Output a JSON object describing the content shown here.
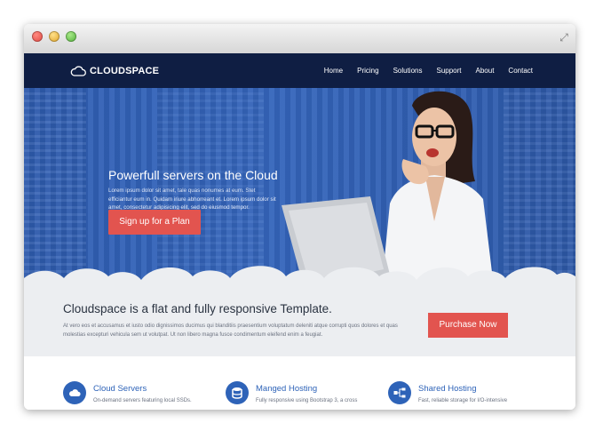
{
  "brand": {
    "name": "CLOUDSPACE"
  },
  "nav": {
    "items": [
      "Home",
      "Pricing",
      "Solutions",
      "Support",
      "About",
      "Contact"
    ]
  },
  "hero": {
    "title": "Powerfull servers on the Cloud",
    "text": "Lorem ipsum dolor sit amet, tale quas nonumes at eum. Stet efficiantur eum in. Quidam iriure abhorreant et. Lorem ipsum dolor sit amet, consectetur adipisicing elit, sed do eiusmod tempor.",
    "cta": "Sign up for a Plan"
  },
  "intro": {
    "title": "Cloudspace is a flat and fully responsive Template.",
    "text": "At vero eos et accusamus et iusto odio dignissimos ducimus qui blanditiis praesentium voluptatum deleniti atque corrupti quos dolores et quas molestias excepturi vehicula sem ut volutpat. Ut non libero magna fusce condimentum eleifend enim a feugiat.",
    "cta": "Purchase Now"
  },
  "features": [
    {
      "title": "Cloud Servers",
      "text": "On-demand servers featuring local SSDs.",
      "icon": "cloud-icon"
    },
    {
      "title": "Manged Hosting",
      "text": "Fully responsive using Bootstrap 3, a cross",
      "icon": "database-icon"
    },
    {
      "title": "Shared Hosting",
      "text": "Fast, reliable storage for I/O-intensive",
      "icon": "network-icon"
    }
  ],
  "colors": {
    "nav": "#0f1e43",
    "hero": "#3566bd",
    "accent": "#e2544f",
    "feature": "#2e63b8"
  }
}
